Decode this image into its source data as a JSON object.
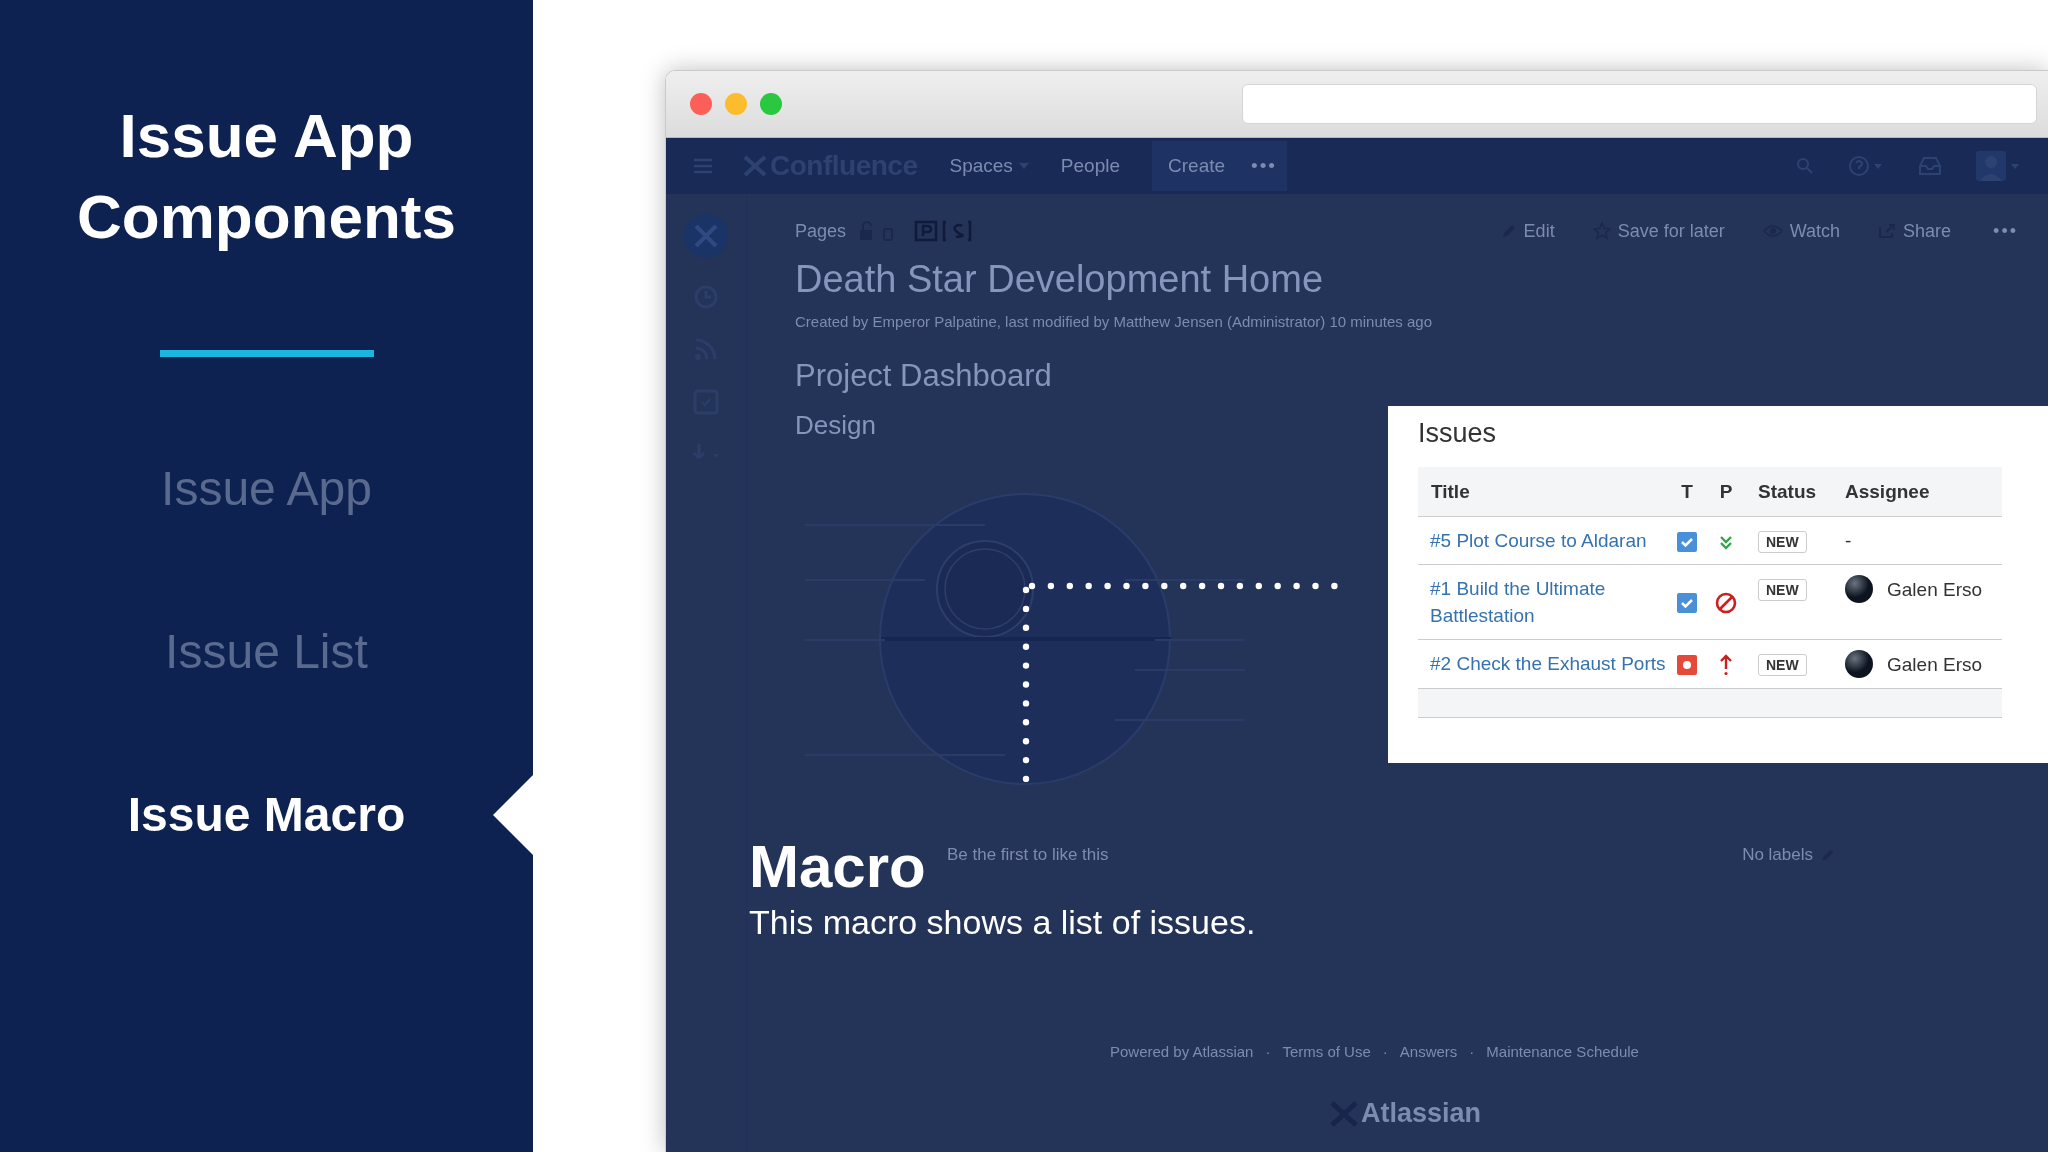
{
  "sidebar": {
    "title": "Issue App Components",
    "items": [
      {
        "label": "Issue App",
        "selected": false
      },
      {
        "label": "Issue List",
        "selected": false
      },
      {
        "label": "Issue Macro",
        "selected": true
      }
    ]
  },
  "confluence": {
    "logo": "Confluence",
    "nav_items": [
      {
        "label": "Spaces",
        "dropdown": true
      },
      {
        "label": "People",
        "dropdown": false
      }
    ],
    "create": "Create",
    "nav_more": "•••",
    "breadcrumb": "Pages",
    "actions": [
      {
        "kind": "edit",
        "label": "Edit"
      },
      {
        "kind": "save",
        "label": "Save for later"
      },
      {
        "kind": "watch",
        "label": "Watch"
      },
      {
        "kind": "share",
        "label": "Share"
      }
    ],
    "actions_more": "•••",
    "page_title": "Death Star Development Home",
    "byline": "Created by Emperor Palpatine, last modified by Matthew Jensen (Administrator) 10 minutes ago",
    "headings": [
      "Project Dashboard",
      "Design"
    ],
    "likes": "Be the first to like this",
    "labels": "No labels",
    "footer_links": [
      "Powered by Atlassian",
      "Terms of Use",
      "Answers",
      "Maintenance Schedule"
    ],
    "footer_separator": "·",
    "footer_logo": "Atlassian"
  },
  "issues_macro": {
    "title": "Issues",
    "columns": [
      "Title",
      "T",
      "P",
      "Status",
      "Assignee"
    ],
    "rows": [
      {
        "title": "#5 Plot Course to Aldaran",
        "type": {
          "kind": "task"
        },
        "priority": {
          "kind": "lowest"
        },
        "status": "NEW",
        "assignee": "-",
        "avatar": false
      },
      {
        "title": "#1 Build the Ultimate Battlestation",
        "type": {
          "kind": "task"
        },
        "priority": {
          "kind": "blocker"
        },
        "status": "NEW",
        "assignee": "Galen Erso",
        "avatar": true
      },
      {
        "title": "#2 Check the Exhaust Ports",
        "type": {
          "kind": "bug"
        },
        "priority": {
          "kind": "high"
        },
        "status": "NEW",
        "assignee": "Galen Erso",
        "avatar": true
      }
    ]
  },
  "caption": {
    "title": "Macro",
    "text": "This macro shows a list of issues."
  }
}
